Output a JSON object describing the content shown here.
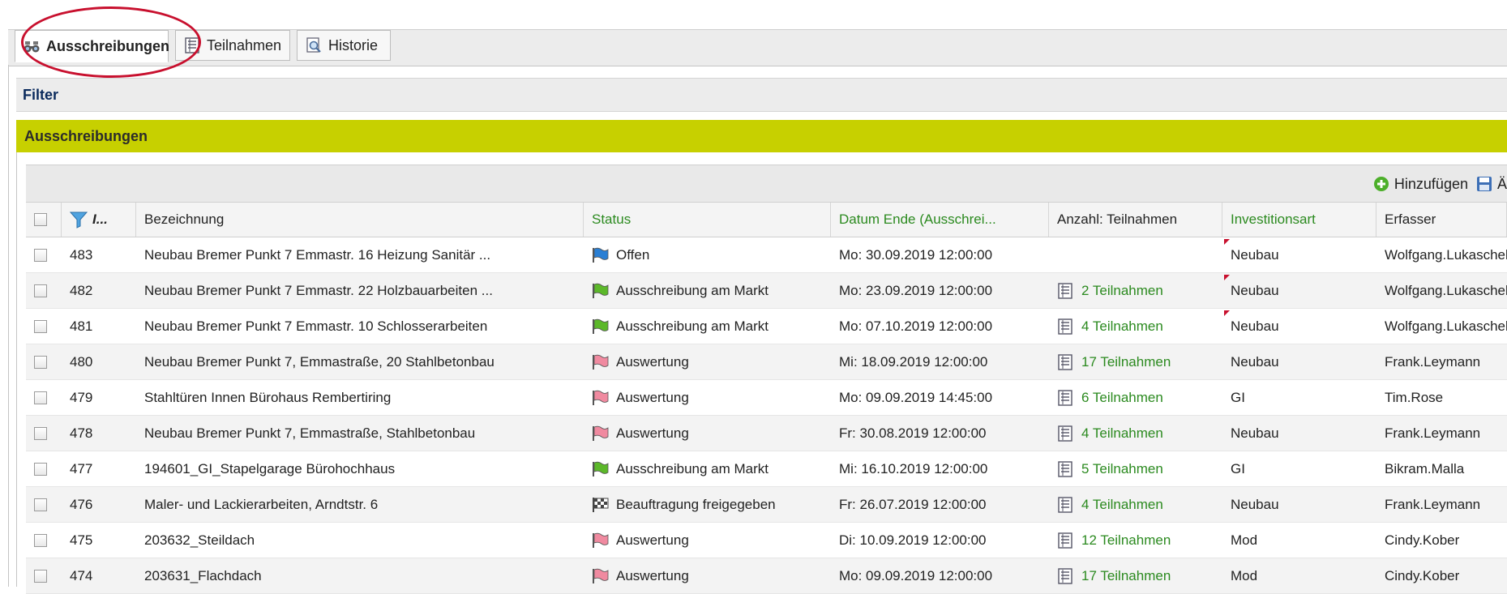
{
  "tabs": [
    {
      "label": "Ausschreibungen",
      "icon": "binoculars-icon",
      "active": true
    },
    {
      "label": "Teilnahmen",
      "icon": "list-document-icon",
      "active": false
    },
    {
      "label": "Historie",
      "icon": "history-magnifier-icon",
      "active": false
    }
  ],
  "filter": {
    "label": "Filter"
  },
  "section": {
    "title": "Ausschreibungen"
  },
  "toolbar": {
    "add_label": "Hinzufügen",
    "edit_label": "Ä"
  },
  "columns": {
    "id": "I...",
    "bezeichnung": "Bezeichnung",
    "status": "Status",
    "datum": "Datum Ende (Ausschrei...",
    "anzahl": "Anzahl: Teilnahmen",
    "invest": "Investitionsart",
    "erfasser": "Erfasser"
  },
  "colors": {
    "accent_green": "#c7d000",
    "link_green": "#2b8a1f",
    "highlight_red": "#c8102e",
    "flag_blue": "#2a7fd4",
    "flag_green": "#5cb82a",
    "flag_pink": "#f08aa0",
    "flag_checkered": "#555555"
  },
  "rows": [
    {
      "id": "483",
      "bez": "Neubau Bremer Punkt 7 Emmastr. 16 Heizung Sanitär ...",
      "status": "Offen",
      "flag": "blue",
      "datum": "Mo: 30.09.2019 12:00:00",
      "anzahl": "",
      "invest": "Neubau",
      "marker": true,
      "erfasser": "Wolfgang.Lukaschek"
    },
    {
      "id": "482",
      "bez": "Neubau Bremer Punkt 7 Emmastr. 22 Holzbauarbeiten ...",
      "status": "Ausschreibung am Markt",
      "flag": "green",
      "datum": "Mo: 23.09.2019 12:00:00",
      "anzahl": "2 Teilnahmen",
      "invest": "Neubau",
      "marker": true,
      "erfasser": "Wolfgang.Lukaschek"
    },
    {
      "id": "481",
      "bez": "Neubau Bremer Punkt 7 Emmastr. 10 Schlosserarbeiten",
      "status": "Ausschreibung am Markt",
      "flag": "green",
      "datum": "Mo: 07.10.2019 12:00:00",
      "anzahl": "4 Teilnahmen",
      "invest": "Neubau",
      "marker": true,
      "erfasser": "Wolfgang.Lukaschek"
    },
    {
      "id": "480",
      "bez": "Neubau Bremer Punkt 7, Emmastraße, 20 Stahlbetonbau",
      "status": "Auswertung",
      "flag": "pink",
      "datum": "Mi: 18.09.2019 12:00:00",
      "anzahl": "17 Teilnahmen",
      "invest": "Neubau",
      "marker": false,
      "erfasser": "Frank.Leymann"
    },
    {
      "id": "479",
      "bez": "Stahltüren Innen Bürohaus Rembertiring",
      "status": "Auswertung",
      "flag": "pink",
      "datum": "Mo: 09.09.2019 14:45:00",
      "anzahl": "6 Teilnahmen",
      "invest": "GI",
      "marker": false,
      "erfasser": "Tim.Rose"
    },
    {
      "id": "478",
      "bez": "Neubau Bremer Punkt 7, Emmastraße, Stahlbetonbau",
      "status": "Auswertung",
      "flag": "pink",
      "datum": "Fr: 30.08.2019 12:00:00",
      "anzahl": "4 Teilnahmen",
      "invest": "Neubau",
      "marker": false,
      "erfasser": "Frank.Leymann"
    },
    {
      "id": "477",
      "bez": "194601_GI_Stapelgarage Bürohochhaus",
      "status": "Ausschreibung am Markt",
      "flag": "green",
      "datum": "Mi: 16.10.2019 12:00:00",
      "anzahl": "5 Teilnahmen",
      "invest": "GI",
      "marker": false,
      "erfasser": "Bikram.Malla"
    },
    {
      "id": "476",
      "bez": "Maler- und Lackierarbeiten, Arndtstr. 6",
      "status": "Beauftragung freigegeben",
      "flag": "checkered",
      "datum": "Fr: 26.07.2019 12:00:00",
      "anzahl": "4 Teilnahmen",
      "invest": "Neubau",
      "marker": false,
      "erfasser": "Frank.Leymann"
    },
    {
      "id": "475",
      "bez": "203632_Steildach",
      "status": "Auswertung",
      "flag": "pink",
      "datum": "Di: 10.09.2019 12:00:00",
      "anzahl": "12 Teilnahmen",
      "invest": "Mod",
      "marker": false,
      "erfasser": "Cindy.Kober"
    },
    {
      "id": "474",
      "bez": "203631_Flachdach",
      "status": "Auswertung",
      "flag": "pink",
      "datum": "Mo: 09.09.2019 12:00:00",
      "anzahl": "17 Teilnahmen",
      "invest": "Mod",
      "marker": false,
      "erfasser": "Cindy.Kober"
    }
  ]
}
